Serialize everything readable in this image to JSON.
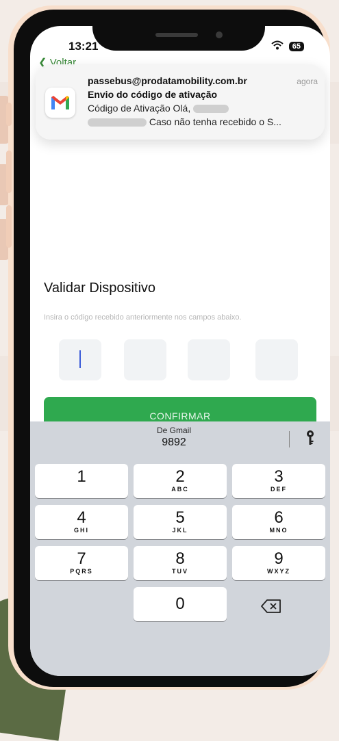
{
  "status_bar": {
    "time": "13:21",
    "battery": "65"
  },
  "nav": {
    "back_label": "Voltar"
  },
  "notification": {
    "sender": "passebus@prodatamobility.com.br",
    "time": "agora",
    "subject": "Envio do código de ativação",
    "line1": "Código de Ativação Olá,",
    "line2": "Caso não tenha recebido o S..."
  },
  "page": {
    "title": "Validar Dispositivo",
    "subtitle": "Insira o código recebido anteriormente nos campos abaixo.",
    "confirm_label": "CONFIRMAR"
  },
  "keyboard": {
    "suggestion_source": "De Gmail",
    "suggestion_code": "9892",
    "keys": [
      {
        "num": "1",
        "letters": ""
      },
      {
        "num": "2",
        "letters": "ABC"
      },
      {
        "num": "3",
        "letters": "DEF"
      },
      {
        "num": "4",
        "letters": "GHI"
      },
      {
        "num": "5",
        "letters": "JKL"
      },
      {
        "num": "6",
        "letters": "MNO"
      },
      {
        "num": "7",
        "letters": "PQRS"
      },
      {
        "num": "8",
        "letters": "TUV"
      },
      {
        "num": "9",
        "letters": "WXYZ"
      },
      {
        "num": "0",
        "letters": ""
      }
    ]
  },
  "colors": {
    "accent": "#2fa94f",
    "back_link": "#3a8a3a",
    "cursor": "#3b5bd8"
  }
}
